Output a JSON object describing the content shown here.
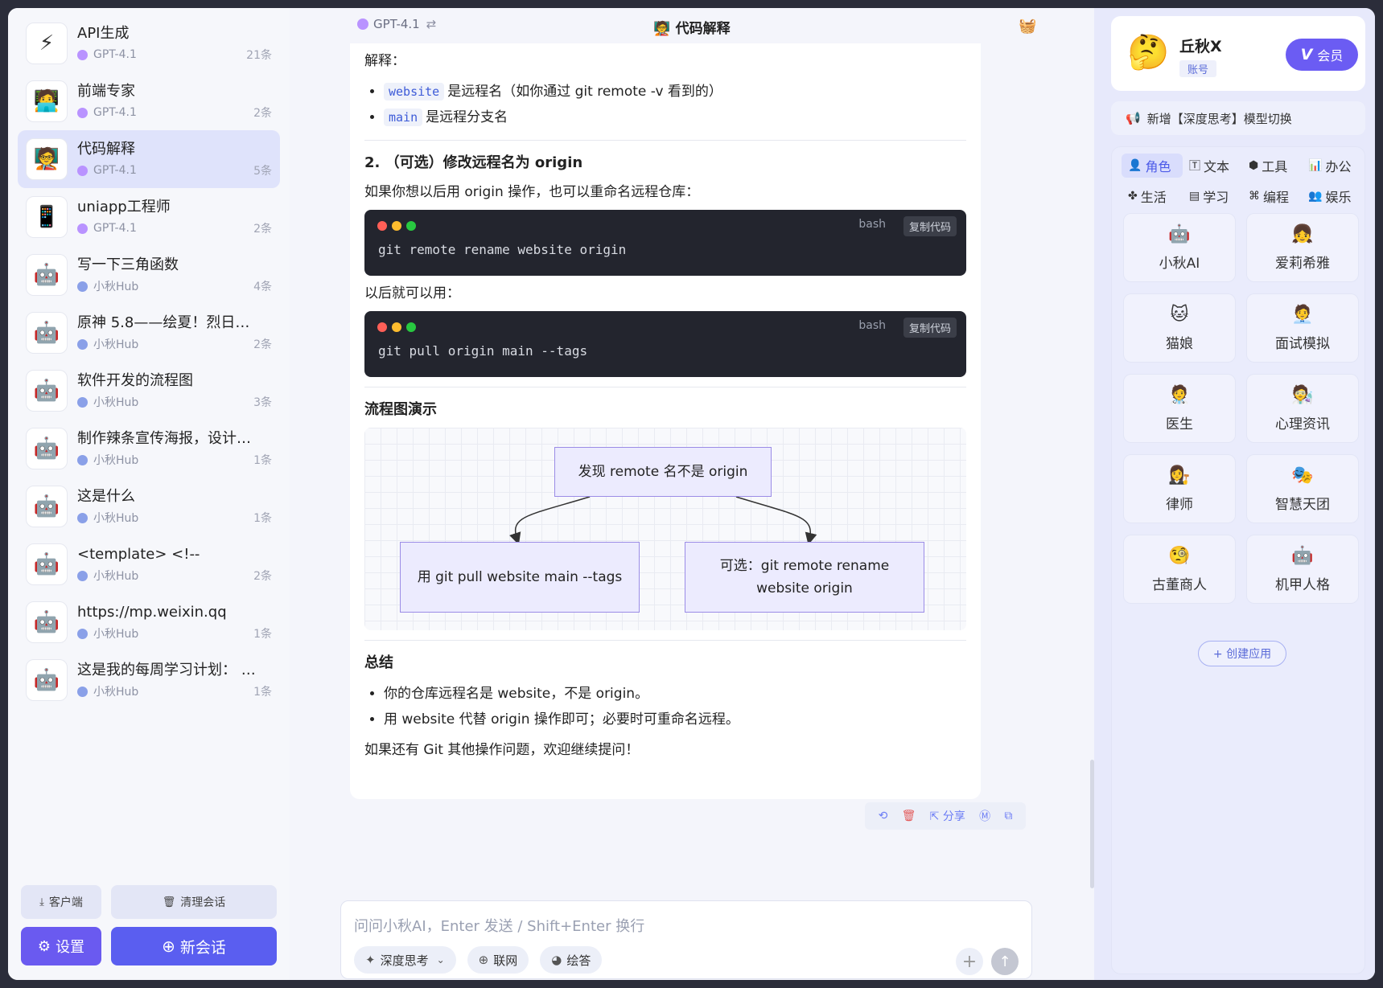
{
  "sidebar": {
    "conversations": [
      {
        "title": "API生成",
        "model": "GPT-4.1",
        "count": "21条",
        "icon": "lightning-icon",
        "dot": "#b993ff"
      },
      {
        "title": "前端专家",
        "model": "GPT-4.1",
        "count": "2条",
        "icon": "developer-icon",
        "dot": "#b993ff"
      },
      {
        "title": "代码解释",
        "model": "GPT-4.1",
        "count": "5条",
        "icon": "code-explain-icon",
        "dot": "#b993ff",
        "active": true
      },
      {
        "title": "uniapp工程师",
        "model": "GPT-4.1",
        "count": "2条",
        "icon": "app-grid-icon",
        "dot": "#b993ff"
      },
      {
        "title": "写一下三角函数",
        "model": "小秋Hub",
        "count": "4条",
        "icon": "robot-crown-icon",
        "dot": "#8aa0e8"
      },
      {
        "title": "原神 5.8——绘夏！烈日？…",
        "model": "小秋Hub",
        "count": "2条",
        "icon": "robot-crown-icon",
        "dot": "#8aa0e8"
      },
      {
        "title": "软件开发的流程图",
        "model": "小秋Hub",
        "count": "3条",
        "icon": "robot-crown-icon",
        "dot": "#8aa0e8"
      },
      {
        "title": "制作辣条宣传海报，设计与…",
        "model": "小秋Hub",
        "count": "1条",
        "icon": "robot-crown-icon",
        "dot": "#8aa0e8"
      },
      {
        "title": "这是什么",
        "model": "小秋Hub",
        "count": "1条",
        "icon": "robot-crown-icon",
        "dot": "#8aa0e8"
      },
      {
        "title": "<template> <!--",
        "model": "小秋Hub",
        "count": "2条",
        "icon": "robot-crown-icon",
        "dot": "#8aa0e8"
      },
      {
        "title": "https://mp.weixin.qq",
        "model": "小秋Hub",
        "count": "1条",
        "icon": "robot-crown-icon",
        "dot": "#8aa0e8"
      },
      {
        "title": "这是我的每周学习计划： 每…",
        "model": "小秋Hub",
        "count": "1条",
        "icon": "robot-crown-icon",
        "dot": "#8aa0e8"
      }
    ],
    "client_label": "客户端",
    "clear_label": "清理会话",
    "settings_label": "设置",
    "new_chat_label": "新会话"
  },
  "header": {
    "model": "GPT-4.1",
    "title": "代码解释"
  },
  "message": {
    "intro": "解释：",
    "bullets1": [
      {
        "code": "website",
        "text": "是远程名（如你通过 git remote -v 看到的）"
      },
      {
        "code": "main",
        "text": "是远程分支名"
      }
    ],
    "section2_title": "2. （可选）修改远程名为 origin",
    "section2_text": "如果你想以后用 origin 操作，也可以重命名远程仓库：",
    "code1": {
      "lang": "bash",
      "copy": "复制代码",
      "code": "git remote rename website origin"
    },
    "later_text": "以后就可以用：",
    "code2": {
      "lang": "bash",
      "copy": "复制代码",
      "code": "git pull origin main --tags"
    },
    "flow_title": "流程图演示",
    "flow": {
      "top": "发现 remote 名不是 origin",
      "left": "用 git pull website main --tags",
      "right": "可选：git remote rename website origin"
    },
    "summary_title": "总结",
    "summary_bullets": [
      "你的仓库远程名是 website，不是 origin。",
      "用 website 代替 origin 操作即可；必要时可重命名远程。"
    ],
    "closing": "如果还有 Git 其他操作问题，欢迎继续提问！"
  },
  "actions": {
    "share_label": "分享"
  },
  "input": {
    "placeholder": "问问小秋AI，Enter 发送 / Shift+Enter 换行",
    "deep_think": "深度思考",
    "web": "联网",
    "draw": "绘答"
  },
  "right": {
    "user_name": "丘秋X",
    "account_label": "账号",
    "vip_label": "会员",
    "notice": "新增【深度思考】模型切换",
    "categories": [
      {
        "label": "角色",
        "icon": "person-icon",
        "active": true
      },
      {
        "label": "文本",
        "icon": "text-icon"
      },
      {
        "label": "工具",
        "icon": "cube-icon"
      },
      {
        "label": "办公",
        "icon": "chart-icon"
      },
      {
        "label": "生活",
        "icon": "puzzle-icon"
      },
      {
        "label": "学习",
        "icon": "document-icon"
      },
      {
        "label": "编程",
        "icon": "code-icon"
      },
      {
        "label": "娱乐",
        "icon": "group-icon"
      }
    ],
    "roles": [
      {
        "label": "小秋AI",
        "icon": "robot-crown-icon"
      },
      {
        "label": "爱莉希雅",
        "icon": "anime-girl-icon"
      },
      {
        "label": "猫娘",
        "icon": "cat-girl-icon"
      },
      {
        "label": "面试模拟",
        "icon": "interviewer-icon"
      },
      {
        "label": "医生",
        "icon": "doctor-icon"
      },
      {
        "label": "心理资讯",
        "icon": "psychologist-icon"
      },
      {
        "label": "律师",
        "icon": "lawyer-icon"
      },
      {
        "label": "智慧天团",
        "icon": "masks-icon"
      },
      {
        "label": "古董商人",
        "icon": "monocle-icon"
      },
      {
        "label": "机甲人格",
        "icon": "robot-icon"
      }
    ],
    "create_app": "+ 创建应用"
  }
}
